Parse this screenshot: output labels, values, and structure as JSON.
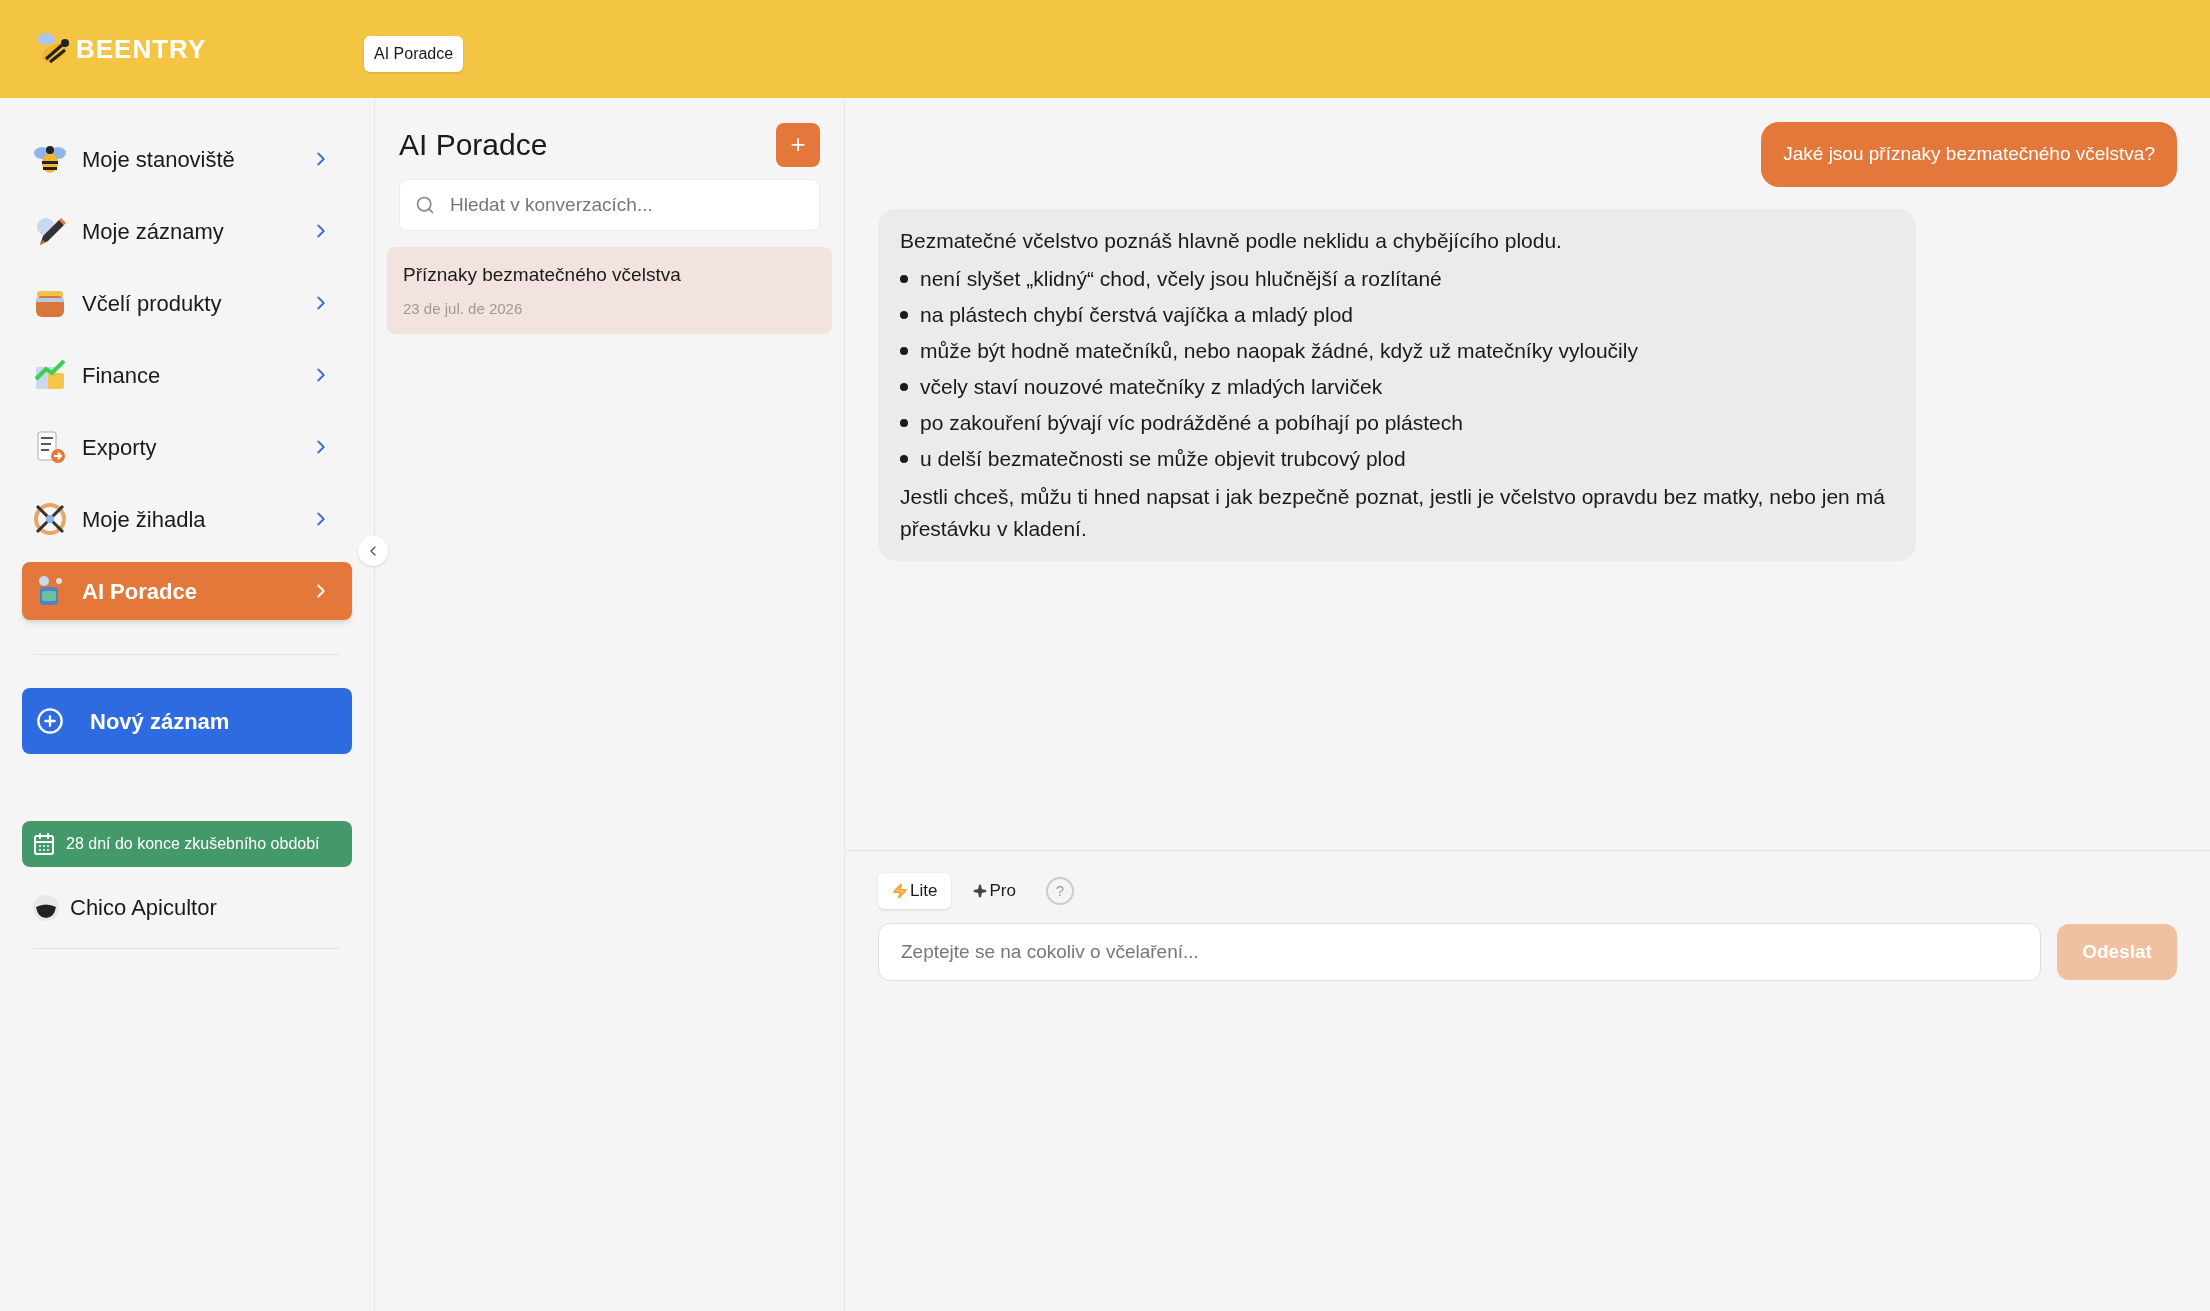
{
  "header": {
    "logo": "BEENTRY",
    "tooltip": "AI Poradce"
  },
  "sidebar": {
    "items": [
      {
        "label": "Moje stanoviště",
        "selected": false
      },
      {
        "label": "Moje záznamy",
        "selected": false
      },
      {
        "label": "Včelí produkty",
        "selected": false
      },
      {
        "label": "Finance",
        "selected": false
      },
      {
        "label": "Exporty",
        "selected": false
      },
      {
        "label": "Moje žihadla",
        "selected": false
      },
      {
        "label": "AI Poradce",
        "selected": true
      }
    ],
    "new_button": "Nový záznam",
    "trial_badge": "28 dní do konce zkušebního období",
    "user": "Chico Apicultor"
  },
  "conversations": {
    "title": "AI Poradce",
    "add_button": "+",
    "search": {
      "placeholder": "Hledat v konverzacích..."
    },
    "items": [
      {
        "title": "Příznaky bezmatečného včelstva",
        "date": "23 de jul. de 2026",
        "selected": true
      }
    ]
  },
  "chat": {
    "messages": [
      {
        "kind": "user",
        "text": "Jaké jsou příznaky bezmatečného včelstva?"
      },
      {
        "kind": "assistant",
        "intro": "Bezmatečné včelstvo poznáš hlavně podle neklidu a chybějícího plodu.",
        "bullets": [
          "není slyšet „klidný“ chod, včely jsou hlučnější a rozlítané",
          "na plástech chybí čerstvá vajíčka a mladý plod",
          "může být hodně matečníků, nebo naopak žádné, když už matečníky vyloučily",
          "včely staví nouzové matečníky z mladých larviček",
          "po zakouření bývají víc podrážděné a pobíhají po plástech",
          "u delší bezmatečnosti se může objevit trubcový plod"
        ],
        "outro": "Jestli chceš, můžu ti hned napsat i jak bezpečně poznat, jestli je včelstvo opravdu bez matky, nebo jen má přestávku v kladení."
      }
    ],
    "modes": [
      {
        "kind": "lite",
        "label": "Lite",
        "selected": true
      },
      {
        "kind": "pro",
        "label": "Pro",
        "selected": false
      }
    ],
    "help": "?",
    "input": {
      "placeholder": "Zeptejte se na cokoliv o včelaření..."
    },
    "send": {
      "label": "Odeslat",
      "disabled": true
    }
  }
}
